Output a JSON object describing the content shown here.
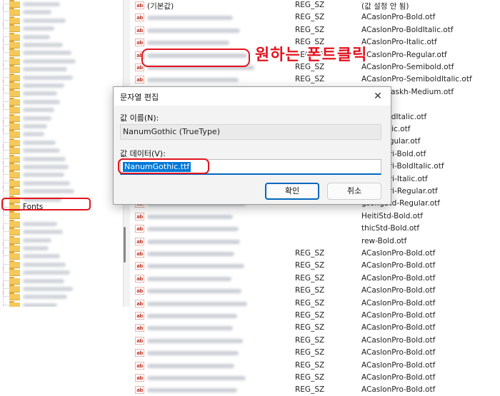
{
  "tree": {
    "selected_label": "Fonts"
  },
  "list": {
    "rows": [
      {
        "name": "(기본값)",
        "type": "REG_SZ",
        "data": "(값 설정 안 됨)"
      },
      {
        "name": "",
        "type": "REG_SZ",
        "data": "ACaslonPro-Bold.otf"
      },
      {
        "name": "",
        "type": "REG_SZ",
        "data": "ACaslonPro-BoldItalic.otf"
      },
      {
        "name": "",
        "type": "REG_SZ",
        "data": "ACaslonPro-Italic.otf"
      },
      {
        "name": "",
        "type": "REG_SZ",
        "data": "ACaslonPro-Regular.otf"
      },
      {
        "name": "",
        "type": "REG_SZ",
        "data": "ACaslonPro-Semibold.otf"
      },
      {
        "name": "",
        "type": "REG_SZ",
        "data": "ACaslonPro-SemiboldItalic.otf"
      },
      {
        "name": "",
        "type": "REG_SZ",
        "data": "AdobeNaskh-Medium.otf"
      },
      {
        "name": "",
        "type": "",
        "data": ""
      },
      {
        "name": "",
        "type": "",
        "data": "abic-BoldItalic.otf"
      },
      {
        "name": "",
        "type": "",
        "data": "abic-Italic.otf"
      },
      {
        "name": "",
        "type": "",
        "data": "abic-Regular.otf"
      },
      {
        "name": "",
        "type": "",
        "data": "vanagari-Bold.otf"
      },
      {
        "name": "",
        "type": "",
        "data": "vanagari-BoldItalic.otf"
      },
      {
        "name": "",
        "type": "",
        "data": "vanagari-Italic.otf"
      },
      {
        "name": "",
        "type": "",
        "data": "vanagari-Regular.otf"
      },
      {
        "name": "",
        "type": "",
        "data": "gsongStd-Regular.otf"
      },
      {
        "name": "",
        "type": "",
        "data": "HeitiStd-Bold.otf"
      },
      {
        "name": "",
        "type": "",
        "data": "thicStd-Bold.otf"
      },
      {
        "name": "",
        "type": "",
        "data": "rew-Bold.otf"
      },
      {
        "name": "",
        "type": "REG_SZ",
        "data": "ACaslonPro-Bold.otf"
      },
      {
        "name": "",
        "type": "REG_SZ",
        "data": "ACaslonPro-Bold.otf"
      },
      {
        "name": "",
        "type": "REG_SZ",
        "data": "ACaslonPro-Bold.otf"
      },
      {
        "name": "",
        "type": "REG_SZ",
        "data": "ACaslonPro-Bold.otf"
      },
      {
        "name": "",
        "type": "REG_SZ",
        "data": "ACaslonPro-Bold.otf"
      },
      {
        "name": "",
        "type": "REG_SZ",
        "data": "ACaslonPro-Bold.otf"
      },
      {
        "name": "",
        "type": "REG_SZ",
        "data": "ACaslonPro-Bold.otf"
      },
      {
        "name": "",
        "type": "REG_SZ",
        "data": "ACaslonPro-Bold.otf"
      },
      {
        "name": "",
        "type": "REG_SZ",
        "data": "ACaslonPro-Bold.otf"
      },
      {
        "name": "",
        "type": "REG_SZ",
        "data": "ACaslonPro-Bold.otf"
      },
      {
        "name": "",
        "type": "REG_SZ",
        "data": "ACaslonPro-Bold.otf"
      },
      {
        "name": "",
        "type": "REG_SZ",
        "data": "ACaslonPro-Bold.otf"
      }
    ]
  },
  "annotation": {
    "text": "원하는 폰트클릭",
    "color": "#e3141f"
  },
  "dialog": {
    "title": "문자열 편집",
    "close_glyph": "✕",
    "name_label": "값 이름(N):",
    "name_value": "NanumGothic (TrueType)",
    "data_label": "값 데이터(V):",
    "data_value": "NanumGothic.ttf",
    "ok_label": "확인",
    "cancel_label": "취소"
  },
  "colors": {
    "highlight_red": "#e3141f",
    "selection_blue": "#0078d7",
    "folder_yellow": "#f4c95a"
  }
}
